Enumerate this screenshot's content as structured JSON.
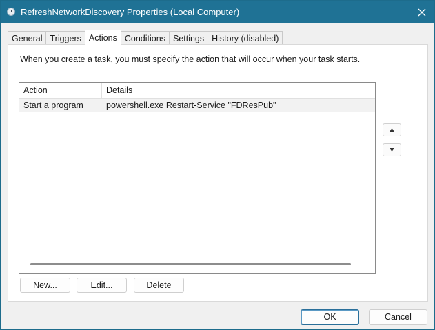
{
  "window": {
    "title": "RefreshNetworkDiscovery Properties (Local Computer)"
  },
  "tabs": [
    {
      "label": "General",
      "active": false
    },
    {
      "label": "Triggers",
      "active": false
    },
    {
      "label": "Actions",
      "active": true
    },
    {
      "label": "Conditions",
      "active": false
    },
    {
      "label": "Settings",
      "active": false
    },
    {
      "label": "History (disabled)",
      "active": false
    }
  ],
  "actions_panel": {
    "instruction": "When you create a task, you must specify the action that will occur when your task starts.",
    "columns": [
      "Action",
      "Details"
    ],
    "rows": [
      {
        "action": "Start a program",
        "details": "powershell.exe Restart-Service \"FDResPub\""
      }
    ],
    "new_label": "New...",
    "edit_label": "Edit...",
    "delete_label": "Delete"
  },
  "footer": {
    "ok_label": "OK",
    "cancel_label": "Cancel"
  },
  "icons": {
    "title": "clock-icon",
    "close": "close-icon",
    "move_up": "chevron-up-icon",
    "move_down": "chevron-down-icon"
  },
  "colors": {
    "titlebar": "#1f7295",
    "accent_border": "#2a6f9a"
  }
}
